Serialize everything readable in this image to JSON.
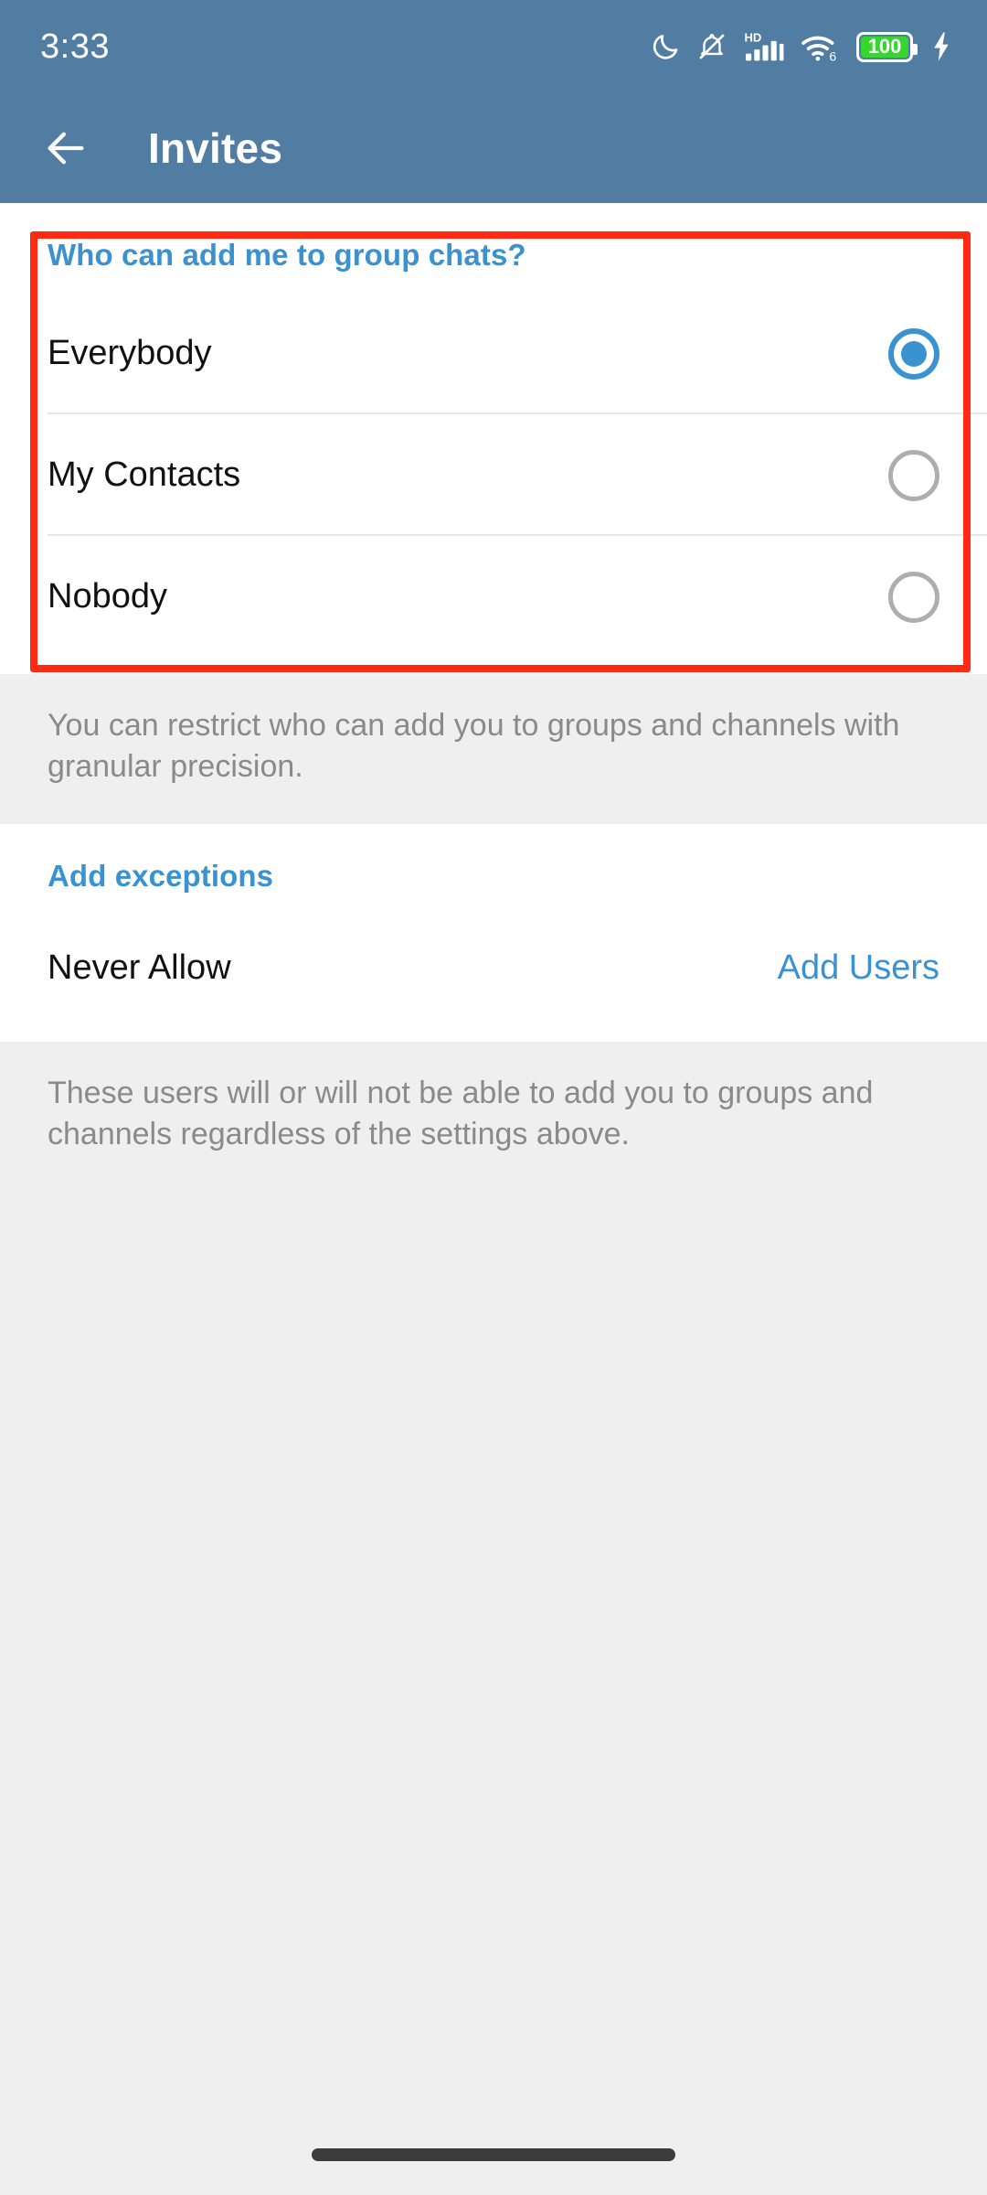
{
  "status_bar": {
    "clock": "3:33",
    "icons": [
      {
        "name": "do-not-disturb-moon-icon",
        "glyph": "moon"
      },
      {
        "name": "notifications-muted-icon",
        "glyph": "bell-slash"
      },
      {
        "name": "hd-signal-icon",
        "glyph": "hd-bars",
        "label": "HD"
      },
      {
        "name": "wifi-6-icon",
        "glyph": "wifi",
        "label": "6"
      },
      {
        "name": "battery-icon",
        "glyph": "battery",
        "level": "100"
      },
      {
        "name": "charging-bolt-icon",
        "glyph": "bolt"
      }
    ],
    "battery_level": "100",
    "battery_color": "#38d430"
  },
  "app_bar": {
    "back_label": "Back",
    "title": "Invites"
  },
  "colors": {
    "header_blue": "#517da2",
    "accent_blue": "#3a92d0",
    "page_background": "#efefef",
    "card_background": "#ffffff",
    "muted_text": "#8a8a8a",
    "annotation_red": "#ff2a10",
    "radio_off": "#aeaeae"
  },
  "invites": {
    "group_chats_section": {
      "header": "Who can add me to group chats?",
      "options": [
        {
          "label": "Everybody",
          "selected": true
        },
        {
          "label": "My Contacts",
          "selected": false
        },
        {
          "label": "Nobody",
          "selected": false
        }
      ],
      "footnote": "You can restrict who can add you to groups and channels with granular precision."
    },
    "exceptions_section": {
      "header": "Add exceptions",
      "rows": [
        {
          "label": "Never Allow",
          "action": "Add Users"
        }
      ],
      "footnote": "These users will or will not be able to add you to groups and channels regardless of the settings above."
    }
  },
  "nav_bar": {
    "gesture_pill": "home-gesture-pill"
  }
}
